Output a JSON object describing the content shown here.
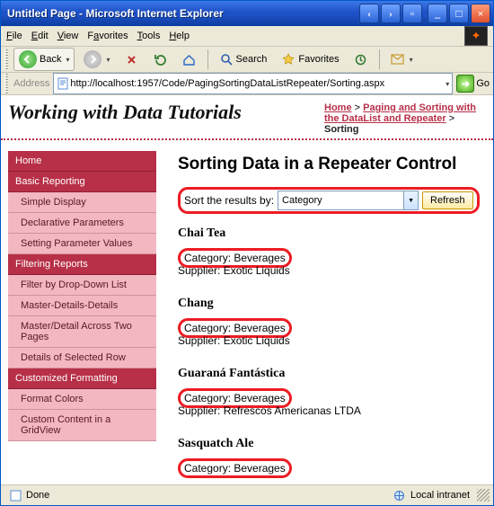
{
  "window": {
    "title": "Untitled Page - Microsoft Internet Explorer"
  },
  "menubar": {
    "file": "File",
    "edit": "Edit",
    "view": "View",
    "favorites": "Favorites",
    "tools": "Tools",
    "help": "Help"
  },
  "toolbar": {
    "back": "Back",
    "search": "Search",
    "favorites": "Favorites"
  },
  "addressbar": {
    "label": "Address",
    "url": "http://localhost:1957/Code/PagingSortingDataListRepeater/Sorting.aspx",
    "go": "Go"
  },
  "page_header": {
    "title": "Working with Data Tutorials"
  },
  "breadcrumb": {
    "home": "Home",
    "sep": ">",
    "section": "Paging and Sorting with the DataList and Repeater",
    "current": "Sorting"
  },
  "nav": {
    "items": [
      {
        "type": "h",
        "label": "Home"
      },
      {
        "type": "h",
        "label": "Basic Reporting"
      },
      {
        "type": "i",
        "label": "Simple Display"
      },
      {
        "type": "i",
        "label": "Declarative Parameters"
      },
      {
        "type": "i",
        "label": "Setting Parameter Values"
      },
      {
        "type": "h",
        "label": "Filtering Reports"
      },
      {
        "type": "i",
        "label": "Filter by Drop-Down List"
      },
      {
        "type": "i",
        "label": "Master-Details-Details"
      },
      {
        "type": "i",
        "label": "Master/Detail Across Two Pages"
      },
      {
        "type": "i",
        "label": "Details of Selected Row"
      },
      {
        "type": "h",
        "label": "Customized Formatting"
      },
      {
        "type": "i",
        "label": "Format Colors"
      },
      {
        "type": "i",
        "label": "Custom Content in a GridView"
      }
    ]
  },
  "main": {
    "heading": "Sorting Data in a Repeater Control",
    "sort_label": "Sort the results by:",
    "sort_selected": "Category",
    "refresh": "Refresh",
    "products": [
      {
        "name": "Chai Tea",
        "category": "Category: Beverages",
        "supplier": "Supplier: Exotic Liquids"
      },
      {
        "name": "Chang",
        "category": "Category: Beverages",
        "supplier": "Supplier: Exotic Liquids"
      },
      {
        "name": "Guaraná Fantástica",
        "category": "Category: Beverages",
        "supplier": "Supplier: Refrescos Americanas LTDA"
      },
      {
        "name": "Sasquatch Ale",
        "category": "Category: Beverages",
        "supplier": ""
      }
    ]
  },
  "statusbar": {
    "done": "Done",
    "zone": "Local intranet"
  }
}
